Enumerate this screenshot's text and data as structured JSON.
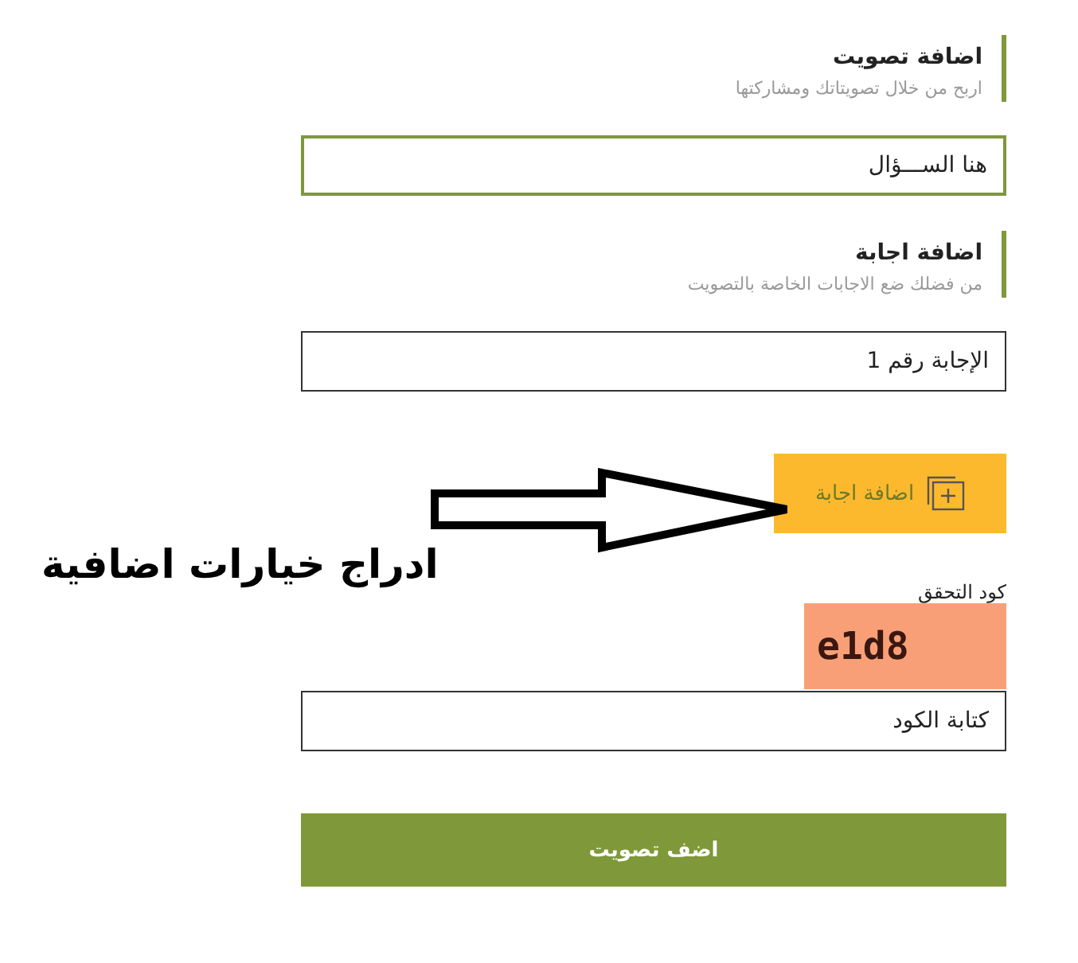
{
  "sections": [
    {
      "title": "اضافة تصويت",
      "subtitle": "اربح من خلال تصويتاتك ومشاركتها",
      "field": {
        "value": "هنا الســـؤال",
        "focused": true
      }
    },
    {
      "title": "اضافة اجابة",
      "subtitle": "من فضلك ضع الاجابات الخاصة بالتصويت",
      "field": {
        "value": "الإجابة رقم 1",
        "focused": false
      }
    }
  ],
  "add_answer_button": "اضافة اجابة",
  "captcha": {
    "label": "كود التحقق",
    "code": "e1d8"
  },
  "code_field": {
    "value": "كتابة الكود",
    "focused": false
  },
  "submit_button": "اضف تصويت",
  "annotation": "ادراج خيارات اضافية"
}
